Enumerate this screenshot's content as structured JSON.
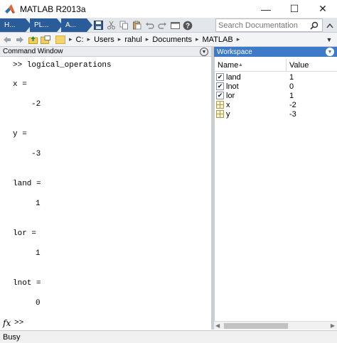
{
  "window": {
    "title": "MATLAB R2013a",
    "minimize_glyph": "—",
    "maximize_glyph": "☐",
    "close_glyph": "✕"
  },
  "toolstrip": {
    "tabs": [
      {
        "label": "H..."
      },
      {
        "label": "PL..."
      },
      {
        "label": "A..."
      }
    ],
    "quick_access_icons": [
      "save-icon",
      "cut-icon",
      "copy-icon",
      "paste-icon",
      "undo-icon",
      "redo-icon",
      "switch-windows-icon",
      "help-icon"
    ],
    "search_placeholder": "Search Documentation"
  },
  "path": {
    "crumbs": [
      "C:",
      "Users",
      "rahul",
      "Documents",
      "MATLAB"
    ]
  },
  "command_window": {
    "title": "Command Window",
    "lines": [
      ">> logical_operations",
      "x =",
      "-2",
      "y =",
      "-3",
      "land =",
      "1",
      "lor =",
      "1",
      "lnot =",
      "0"
    ],
    "prompt": ">>",
    "fx_label": "fx"
  },
  "workspace": {
    "title": "Workspace",
    "columns": {
      "name": "Name",
      "value": "Value"
    },
    "variables": [
      {
        "name": "land",
        "value": "1",
        "type": "logical"
      },
      {
        "name": "lnot",
        "value": "0",
        "type": "logical"
      },
      {
        "name": "lor",
        "value": "1",
        "type": "logical"
      },
      {
        "name": "x",
        "value": "-2",
        "type": "numeric"
      },
      {
        "name": "y",
        "value": "-3",
        "type": "numeric"
      }
    ]
  },
  "status": {
    "text": "Busy"
  },
  "colors": {
    "toolstrip_tab": "#2b5c9a",
    "workspace_header": "#3d7bc8"
  }
}
